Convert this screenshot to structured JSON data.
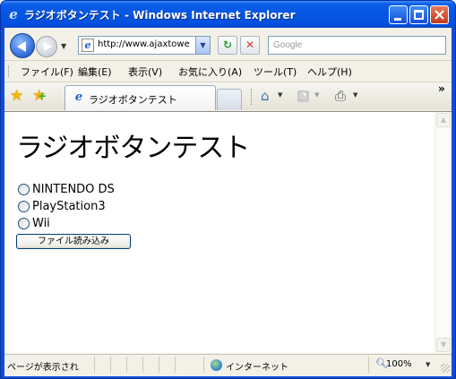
{
  "window": {
    "title": "ラジオボタンテスト - Windows Internet Explorer"
  },
  "toolbar": {
    "address_url": "http://www.ajaxtowe",
    "search_placeholder": "Google",
    "refresh_icon": "refresh-icon",
    "stop_icon": "stop-icon"
  },
  "menu": {
    "items": [
      {
        "label": "ファイル(F)"
      },
      {
        "label": "編集(E)"
      },
      {
        "label": "表示(V)"
      },
      {
        "label": "お気に入り(A)"
      },
      {
        "label": "ツール(T)"
      },
      {
        "label": "ヘルプ(H)"
      }
    ]
  },
  "tabs": {
    "active_label": "ラジオボタンテスト"
  },
  "page": {
    "heading": "ラジオボタンテスト",
    "options": [
      {
        "label": "NINTENDO DS"
      },
      {
        "label": "PlayStation3"
      },
      {
        "label": "Wii"
      }
    ],
    "button_label": "ファイル読み込み"
  },
  "status": {
    "message": "ページが表示され",
    "zone": "インターネット",
    "zoom": "100%"
  }
}
